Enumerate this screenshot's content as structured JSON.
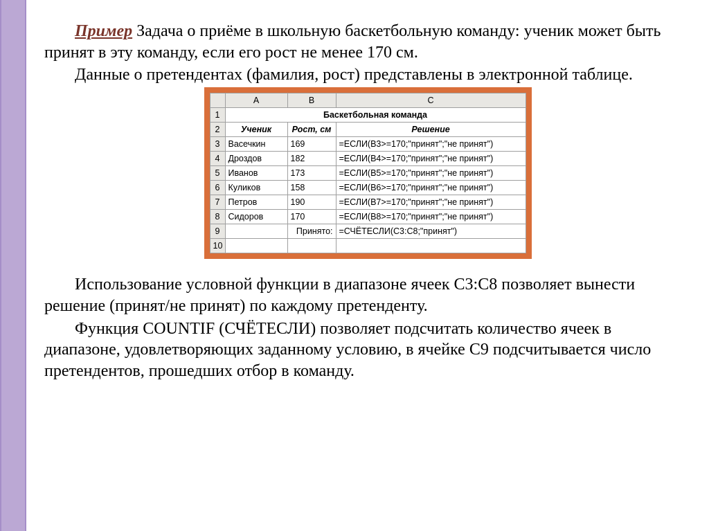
{
  "top": {
    "example_label": "Пример",
    "line1_rest": " Задача о приёме в школьную баскетбольную команду: ученик может быть принят в эту команду, если его рост не менее 170 см.",
    "line2": "Данные о претендентах (фамилия, рост) представлены в электронной таблице."
  },
  "sheet": {
    "columns": {
      "A": "A",
      "B": "B",
      "C": "C"
    },
    "title": "Баскетбольная команда",
    "headers": {
      "student": "Ученик",
      "height": "Рост, см",
      "decision": "Решение"
    },
    "rows": [
      {
        "n": "1"
      },
      {
        "n": "2"
      },
      {
        "n": "3",
        "a": "Васечкин",
        "b": "169",
        "c": "=ЕСЛИ(B3>=170;\"принят\";\"не принят\")"
      },
      {
        "n": "4",
        "a": "Дроздов",
        "b": "182",
        "c": "=ЕСЛИ(B4>=170;\"принят\";\"не принят\")"
      },
      {
        "n": "5",
        "a": "Иванов",
        "b": "173",
        "c": "=ЕСЛИ(B5>=170;\"принят\";\"не принят\")"
      },
      {
        "n": "6",
        "a": "Куликов",
        "b": "158",
        "c": "=ЕСЛИ(B6>=170;\"принят\";\"не принят\")"
      },
      {
        "n": "7",
        "a": "Петров",
        "b": "190",
        "c": "=ЕСЛИ(B7>=170;\"принят\";\"не принят\")"
      },
      {
        "n": "8",
        "a": "Сидоров",
        "b": "170",
        "c": "=ЕСЛИ(B8>=170;\"принят\";\"не принят\")"
      },
      {
        "n": "9",
        "a": "",
        "b": "Принято:",
        "c": "=СЧЁТЕСЛИ(C3:C8;\"принят\")"
      },
      {
        "n": "10"
      }
    ]
  },
  "bottom": {
    "p1": "Использование условной функции в диапазоне ячеек C3:C8 позволяет вынести решение (принят/не принят) по каждому претенденту.",
    "p2": "Функция COUNTIF (СЧЁТЕСЛИ) позволяет подсчитать количество ячеек в диапазоне, удовлетворяющих заданному условию, в ячейке C9 подсчитывается число претендентов, прошедших отбор в команду."
  }
}
